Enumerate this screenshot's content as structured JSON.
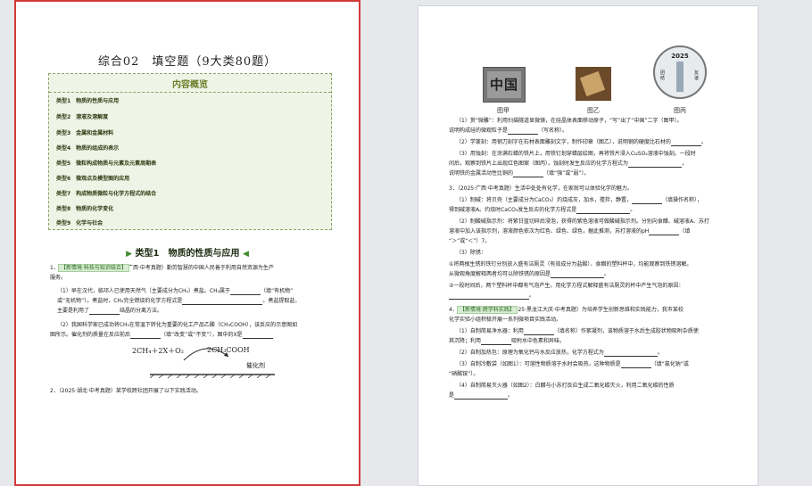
{
  "left": {
    "title": "综合02　填空题（9大类80题）",
    "overview_title": "内容概览",
    "overview_items": [
      "类型1　物质的性质与应用",
      "类型2　溶液及溶解度",
      "类型3　金属和金属材料",
      "类型4　物质的组成的表示",
      "类型5　微粒构成物质与元素及元素周期表",
      "类型6　微观点及模型图的应用",
      "类型7　构成物质微粒与化学方程式的结合",
      "类型8　物质的化学变化",
      "类型9　化学与社会"
    ],
    "section_title": "类型1　物质的性质与应用",
    "q1_tag": "【新情境·科技与知识结合】",
    "q1_line1": "1．　　　　　　　　　　（2025·广西·中考真题）勤劳智慧的中国人民善于利用自然资源为生产",
    "q1_line2": "服务。",
    "q1_p1a": "（1）早在汉代，临邛人已使用天然气（主要成分为CH₄）煮盐。CH₄属于",
    "q1_p1a_tail": "（填“有机物”",
    "q1_p1b": "或“无机物”）。煮盐时，CH₄完全燃烧的化学方程式是",
    "q1_p1b_tail": "。煮盐提取盐，",
    "q1_p1c": "主要是利用了",
    "q1_p1c_tail": "结晶的分离方法。",
    "q1_p2a": "（2）我国科学家已成功将CH₄在常温下转化为重要的化工产品乙酸（CH₃COOH），该反应的示意图如",
    "q1_p2b": "图所示。催化剂的质量在反应前后",
    "q1_p2b_mid": "（填“改变”或“不变”），图中的X是",
    "equation": "2CH₄＋2X＋O₂",
    "product": "2CH₃COOH",
    "catalyst": "催化剂",
    "q2": "2．（2025·湖北·中考真题）某学校跨社团开展了以下实践活动。"
  },
  "right": {
    "captions": [
      "图甲",
      "图乙",
      "图丙"
    ],
    "stamp_text": "中国",
    "coin_year": "2025",
    "coin_left": "团结",
    "coin_right": "友谊",
    "lines": [
      "（1）赏“微雕”：利用扫描隧道显微镜，在硅晶体表面移动原子，“写”出了“中国”二字（图甲）。",
      "说明构成硅的微观粒子是",
      "（写名称）。",
      "（2）学篆刻：用钢刀刻字在石材表面雕刻文字，制作印章（图乙），说明钢的硬度比石材的",
      "。",
      "（3）用蚀刻：在涂满石蜡的铁片上，用铁钉划穿蜡层绘图，再将铁片浸入CuSO₄溶液中蚀刻。一段时",
      "间后，观察到铁片上出现红色图案（图丙）。蚀刻时发生反应的化学方程式为",
      "，",
      "说明铁的金属活动性比铜的",
      "（填“强”或“弱”）。",
      "3．（2025·广西·中考真题）生活中处处有化学，在家就可以体验化学的魅力。",
      "（1）制碱：将贝壳（主要成分为CaCO₃）灼烧成灰，加水，搅拌，静置，",
      "（填操作名称），",
      "得到碱溶液A。灼烧时CaCO₃发生反应的化学方程式是",
      "。",
      "（2）制酸碱指示剂：将紫甘蓝切碎后浸泡，获得的紫色溶液可做酸碱指示剂。分别向食醋、碱溶液A、苏打",
      "溶液中加入该指示剂，溶液颜色依次为红色、绿色、绿色，据此推测，苏打溶液的pH",
      "（填",
      "“＞”或“＜”）7。",
      "（3）除锈：",
      "①将两根生锈的铁钉分别放入盛有洁厕灵（有效成分为盐酸）、食醋的塑料杯中，均能观察到铁锈溶解。",
      "从微观角度解释两者均可以除铁锈的原因是",
      "。",
      "②一段时间后，两个塑料杯中都有气泡产生。用化学方程式解释盛有洁厕灵的杯中产生气泡的原因：",
      "。",
      "4．　　　　　　　　　　（2025·黑龙江大庆·中考真题）为培养学生创新思维和实践能力，我市某校",
      "化学实验小组积极开展一系列微项目实践活动。",
      "（1）自制简易净水器：利用",
      "（填名称）作絮凝剂，该物质溶于水后生成胶状物吸附杂质使",
      "其沉降；利用",
      "吸附水中色素和异味。",
      "（2）自制加热包：原理为氧化钙与水反应放热，化学方程式为",
      "。",
      "（3）自制冷敷袋（如图1）：可溶性物质溶于水时会吸热，这种物质是",
      "（填“氯化钠”或",
      "“硝酸铵”）。",
      "（4）自制简易灭火器（如图2）：白醋与小苏打反应生成二氧化碳灭火，利用二氧化碳的性质",
      "是",
      "。"
    ],
    "q4_tag": "【新情境·跨学科实践】"
  }
}
